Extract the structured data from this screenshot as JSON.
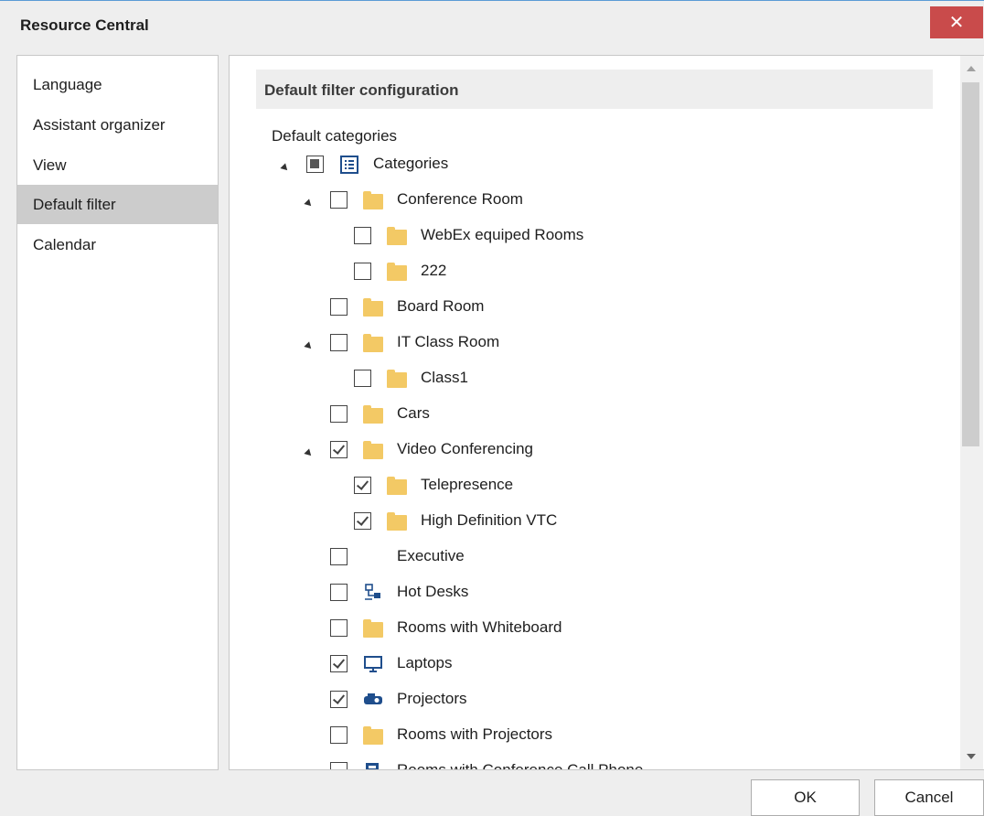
{
  "window": {
    "title": "Resource Central",
    "close_glyph": "✕"
  },
  "sidebar": {
    "items": [
      {
        "label": "Language",
        "active": false
      },
      {
        "label": "Assistant organizer",
        "active": false
      },
      {
        "label": "View",
        "active": false
      },
      {
        "label": "Default filter",
        "active": true
      },
      {
        "label": "Calendar",
        "active": false
      }
    ]
  },
  "main": {
    "section_title": "Default filter configuration",
    "tree_label": "Default categories",
    "tree": [
      {
        "label": "Categories",
        "state": "partial",
        "icon": "list-icon",
        "expanded": true
      },
      {
        "label": "Conference Room",
        "state": "unchecked",
        "icon": "folder-icon",
        "expanded": true
      },
      {
        "label": "WebEx equiped Rooms",
        "state": "unchecked",
        "icon": "folder-icon"
      },
      {
        "label": "222",
        "state": "unchecked",
        "icon": "folder-icon"
      },
      {
        "label": "Board Room",
        "state": "unchecked",
        "icon": "folder-icon"
      },
      {
        "label": "IT Class Room",
        "state": "unchecked",
        "icon": "folder-icon",
        "expanded": true
      },
      {
        "label": "Class1",
        "state": "unchecked",
        "icon": "folder-icon"
      },
      {
        "label": "Cars",
        "state": "unchecked",
        "icon": "folder-icon"
      },
      {
        "label": "Video Conferencing",
        "state": "checked",
        "icon": "folder-icon",
        "expanded": true
      },
      {
        "label": "Telepresence",
        "state": "checked",
        "icon": "folder-icon"
      },
      {
        "label": "High Definition VTC",
        "state": "checked",
        "icon": "folder-icon"
      },
      {
        "label": "Executive",
        "state": "unchecked",
        "icon": "none"
      },
      {
        "label": "Hot Desks",
        "state": "unchecked",
        "icon": "network-icon"
      },
      {
        "label": "Rooms with Whiteboard",
        "state": "unchecked",
        "icon": "folder-icon"
      },
      {
        "label": "Laptops",
        "state": "checked",
        "icon": "monitor-icon"
      },
      {
        "label": "Projectors",
        "state": "checked",
        "icon": "projector-icon"
      },
      {
        "label": "Rooms with Projectors",
        "state": "unchecked",
        "icon": "folder-icon"
      },
      {
        "label": "Rooms with Conference Call Phone",
        "state": "unchecked",
        "icon": "phone-icon"
      }
    ]
  },
  "footer": {
    "ok_label": "OK",
    "cancel_label": "Cancel"
  },
  "colors": {
    "close": "#c94b4b",
    "folder": "#f3c965",
    "icon_blue": "#1f4e8c",
    "active_item": "#cccccc"
  }
}
